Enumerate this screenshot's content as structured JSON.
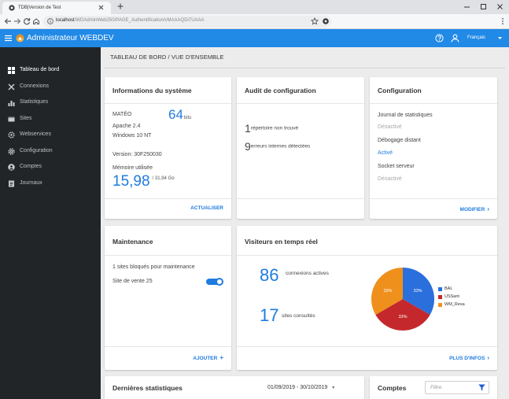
{
  "browser": {
    "tab_title": "TDB|Version de Test",
    "url_host": "localhost",
    "url_path": "/WDAdminWeb250/PAGE_Authentification/vMAAAQDi7UAAA"
  },
  "header": {
    "title": "Administrateur WEBDEV",
    "language": "Français"
  },
  "sidebar": {
    "items": [
      {
        "label": "Tableau de bord",
        "icon": "dashboard-icon",
        "active": true
      },
      {
        "label": "Connexions",
        "icon": "connections-icon",
        "active": false
      },
      {
        "label": "Statistiques",
        "icon": "bar-chart-icon",
        "active": false
      },
      {
        "label": "Sites",
        "icon": "sites-icon",
        "active": false
      },
      {
        "label": "Webservices",
        "icon": "webservices-icon",
        "active": false
      },
      {
        "label": "Configuration",
        "icon": "gear-icon",
        "active": false
      },
      {
        "label": "Comptes",
        "icon": "account-icon",
        "active": false
      },
      {
        "label": "Journaux",
        "icon": "journal-icon",
        "active": false
      }
    ]
  },
  "breadcrumb": "TABLEAU DE BORD / VUE D'ENSEMBLE",
  "system_info": {
    "title": "Informations du système",
    "server_name": "MATÉO",
    "arch_value": "64",
    "arch_unit": "bits",
    "server": "Apache 2.4",
    "os": "Windows 10 NT",
    "version": "Version: 30F250030",
    "memory_label": "Mémoire utilisée",
    "memory_used": "15,98",
    "memory_total": "/ 31,94 Go",
    "refresh_label": "ACTUALISER"
  },
  "audit": {
    "title": "Audit de configuration",
    "items": [
      {
        "count": "1",
        "text": "répertoire non trouvé"
      },
      {
        "count": "9",
        "text": "erreurs internes détectées"
      }
    ]
  },
  "configuration": {
    "title": "Configuration",
    "settings": [
      {
        "name": "Journal de statistiques",
        "status": "Désactivé",
        "enabled": false
      },
      {
        "name": "Débogage distant",
        "status": "Activé",
        "enabled": true
      },
      {
        "name": "Socket serveur",
        "status": "Désactivé",
        "enabled": false
      }
    ],
    "modify_label": "MODIFIER"
  },
  "maintenance": {
    "title": "Maintenance",
    "summary": "1 sites bloqués pour maintenance",
    "sites": [
      {
        "name": "Site de vente 25",
        "blocked": true
      }
    ],
    "add_label": "AJOUTER"
  },
  "visitors": {
    "title": "Visiteurs en temps réel",
    "active_connections": "86",
    "active_connections_label": "connexions actives",
    "sites_visited": "17",
    "sites_visited_label": "sites consultés",
    "more_label": "PLUS D'INFOS"
  },
  "chart_data": {
    "type": "pie",
    "categories": [
      "BAL",
      "USSant",
      "WM_Resa"
    ],
    "values": [
      33,
      33,
      33
    ],
    "labels": [
      "33%",
      "33%",
      "33%"
    ],
    "colors": [
      "#2a6fdc",
      "#c4282d",
      "#ef901c"
    ]
  },
  "stats": {
    "title": "Dernières statistiques",
    "date_range": "01/09/2019 - 30/10/2019"
  },
  "accounts": {
    "title": "Comptes",
    "filter_placeholder": "Filtre"
  },
  "colors": {
    "accent": "#1e7be0",
    "header": "#2189e6",
    "sidebar": "#222527",
    "error": "#d32f2f"
  }
}
